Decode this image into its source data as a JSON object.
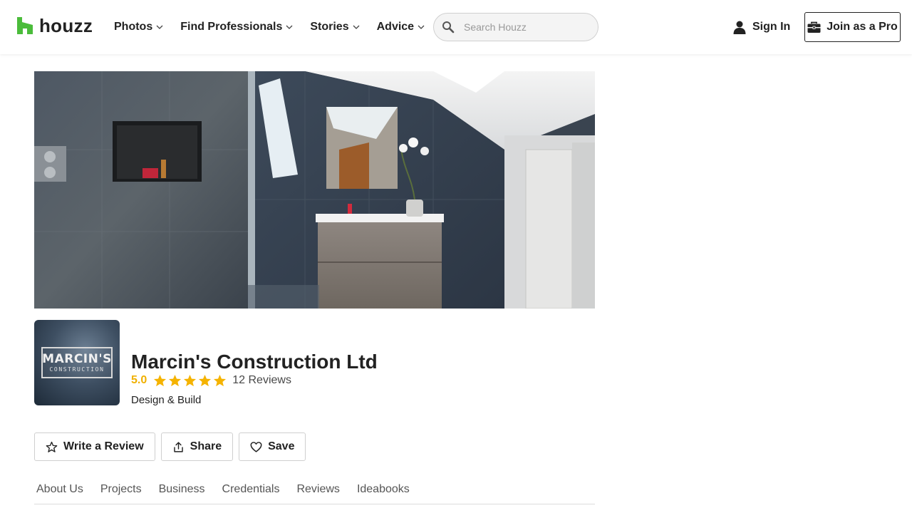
{
  "header": {
    "brand": "houzz",
    "brand_color": "#4bbc3b",
    "nav": [
      {
        "label": "Photos",
        "icon": "chevron-down-icon"
      },
      {
        "label": "Find Professionals",
        "icon": "chevron-down-icon"
      },
      {
        "label": "Stories",
        "icon": "chevron-down-icon"
      },
      {
        "label": "Advice",
        "icon": "chevron-down-icon"
      }
    ],
    "search": {
      "placeholder": "Search Houzz",
      "value": "",
      "icon": "search-icon"
    },
    "sign_in_label": "Sign In",
    "join_label": "Join as a Pro"
  },
  "hero": {
    "description_icon": "bathroom-photo"
  },
  "profile": {
    "avatar_logo_main": "MARCIN'S",
    "avatar_logo_sub": "CONSTRUCTION",
    "name": "Marcin's Construction Ltd",
    "rating": "5.0",
    "stars": 5,
    "star_color": "#f5b300",
    "reviews_label": "12 Reviews",
    "category": "Design & Build"
  },
  "actions": [
    {
      "label": "Write a Review",
      "icon": "star-outline-icon"
    },
    {
      "label": "Share",
      "icon": "share-icon"
    },
    {
      "label": "Save",
      "icon": "heart-icon"
    }
  ],
  "tabs": [
    {
      "label": "About Us"
    },
    {
      "label": "Projects"
    },
    {
      "label": "Business"
    },
    {
      "label": "Credentials"
    },
    {
      "label": "Reviews"
    },
    {
      "label": "Ideabooks"
    }
  ]
}
